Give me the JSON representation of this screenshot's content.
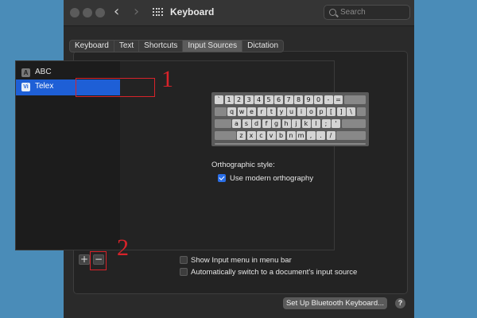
{
  "window": {
    "title": "Keyboard",
    "search_placeholder": "Search",
    "nav_back": "‹",
    "nav_forward": "›"
  },
  "tabs": [
    {
      "label": "Keyboard",
      "active": false
    },
    {
      "label": "Text",
      "active": false
    },
    {
      "label": "Shortcuts",
      "active": false
    },
    {
      "label": "Input Sources",
      "active": true
    },
    {
      "label": "Dictation",
      "active": false
    }
  ],
  "input_sources": [
    {
      "label": "ABC",
      "icon": "A",
      "selected": false
    },
    {
      "label": "Telex",
      "icon": "Vi",
      "selected": true
    }
  ],
  "keyboard": {
    "rows": [
      [
        "`",
        "1",
        "2",
        "3",
        "4",
        "5",
        "6",
        "7",
        "8",
        "9",
        "0",
        "-",
        "="
      ],
      [
        "q",
        "w",
        "e",
        "r",
        "t",
        "y",
        "u",
        "i",
        "o",
        "p",
        "[",
        "]",
        "\\"
      ],
      [
        "a",
        "s",
        "d",
        "f",
        "g",
        "h",
        "j",
        "k",
        "l",
        ";",
        "'"
      ],
      [
        "z",
        "x",
        "c",
        "v",
        "b",
        "n",
        "m",
        ",",
        ".",
        "/"
      ]
    ]
  },
  "orthographic": {
    "label": "Orthographic style:",
    "option_label": "Use modern orthography",
    "checked": true
  },
  "list_buttons": {
    "add": "+",
    "remove": "−"
  },
  "options": [
    {
      "label": "Show Input menu in menu bar",
      "checked": false
    },
    {
      "label": "Automatically switch to a document's input source",
      "checked": false
    }
  ],
  "bluetooth_button": "Set Up Bluetooth Keyboard...",
  "help_button": "?",
  "annotations": [
    "1",
    "2"
  ],
  "colors": {
    "accent": "#1e5fd6",
    "annotation": "#d8232a",
    "backdrop": "#4a8cb8"
  }
}
